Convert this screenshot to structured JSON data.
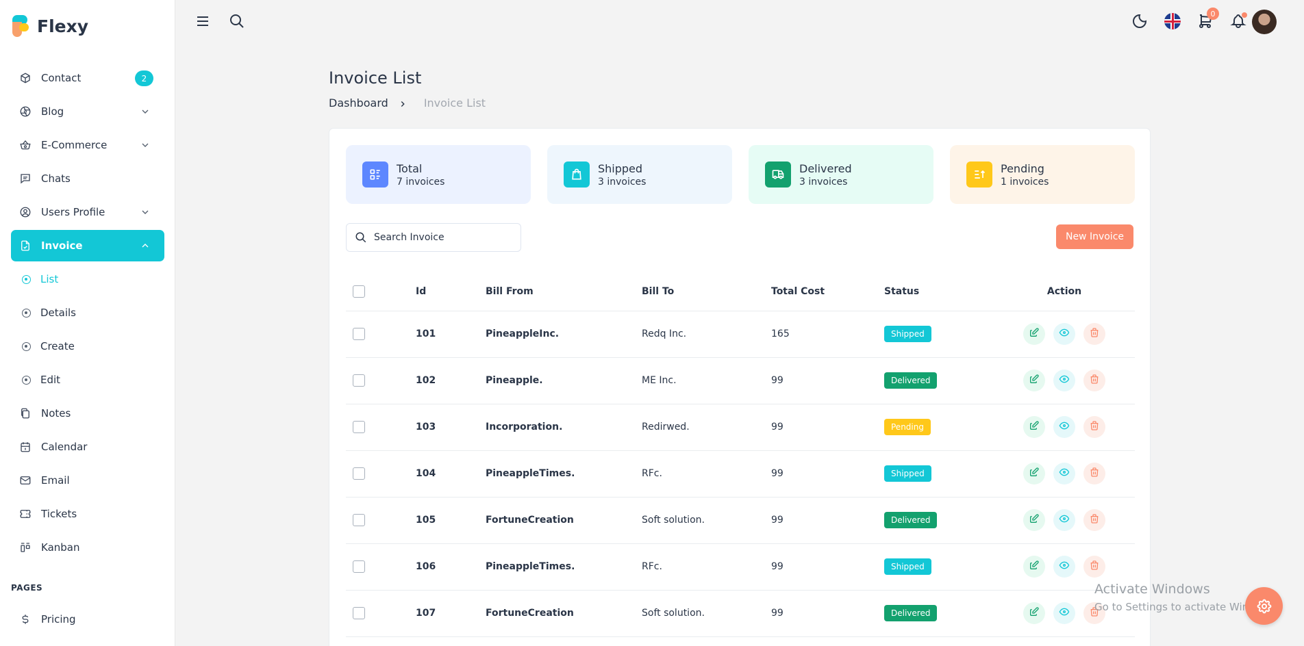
{
  "brand": {
    "name": "Flexy"
  },
  "sidebar": {
    "items": [
      {
        "label": "Contact",
        "badge": "2",
        "icon": "package-icon"
      },
      {
        "label": "Blog",
        "icon": "aperture-icon"
      },
      {
        "label": "E-Commerce",
        "icon": "basket-icon"
      },
      {
        "label": "Chats",
        "icon": "message-icon"
      },
      {
        "label": "Users Profile",
        "icon": "user-circle-icon"
      },
      {
        "label": "Invoice",
        "icon": "file-check-icon"
      }
    ],
    "sub_items": [
      {
        "label": "List"
      },
      {
        "label": "Details"
      },
      {
        "label": "Create"
      },
      {
        "label": "Edit"
      }
    ],
    "more_items": [
      {
        "label": "Notes",
        "icon": "notes-icon"
      },
      {
        "label": "Calendar",
        "icon": "calendar-icon"
      },
      {
        "label": "Email",
        "icon": "mail-icon"
      },
      {
        "label": "Tickets",
        "icon": "ticket-icon"
      },
      {
        "label": "Kanban",
        "icon": "kanban-icon"
      }
    ],
    "section_label": "PAGES",
    "bottom_items": [
      {
        "label": "Pricing",
        "icon": "currency-dollar-icon"
      }
    ]
  },
  "topbar": {
    "cart_count": "0"
  },
  "page": {
    "title": "Invoice List",
    "breadcrumb": [
      "Dashboard",
      "Invoice List"
    ]
  },
  "stats": [
    {
      "title": "Total",
      "subtitle": "7 invoices",
      "color": "#5d87ff",
      "bg": "#ecf2ff"
    },
    {
      "title": "Shipped",
      "subtitle": "3 invoices",
      "color": "#13c7d6",
      "bg": "#eef6fd"
    },
    {
      "title": "Delivered",
      "subtitle": "3 invoices",
      "color": "#13a16e",
      "bg": "#e6fcf5"
    },
    {
      "title": "Pending",
      "subtitle": "1 invoices",
      "color": "#ffc81a",
      "bg": "#fef4e8"
    }
  ],
  "search": {
    "placeholder": "Search Invoice"
  },
  "new_invoice_label": "New Invoice",
  "table": {
    "headers": [
      "Id",
      "Bill From",
      "Bill To",
      "Total Cost",
      "Status",
      "Action"
    ],
    "rows": [
      {
        "id": "101",
        "from": "PineappleInc.",
        "to": "Redq Inc.",
        "cost": "165",
        "status": "Shipped"
      },
      {
        "id": "102",
        "from": "Pineapple.",
        "to": "ME Inc.",
        "cost": "99",
        "status": "Delivered"
      },
      {
        "id": "103",
        "from": "Incorporation.",
        "to": "Redirwed.",
        "cost": "99",
        "status": "Pending"
      },
      {
        "id": "104",
        "from": "PineappleTimes.",
        "to": "RFc.",
        "cost": "99",
        "status": "Shipped"
      },
      {
        "id": "105",
        "from": "FortuneCreation",
        "to": "Soft solution.",
        "cost": "99",
        "status": "Delivered"
      },
      {
        "id": "106",
        "from": "PineappleTimes.",
        "to": "RFc.",
        "cost": "99",
        "status": "Shipped"
      },
      {
        "id": "107",
        "from": "FortuneCreation",
        "to": "Soft solution.",
        "cost": "99",
        "status": "Delivered"
      }
    ]
  },
  "status_colors": {
    "Shipped": "#13c7d6",
    "Delivered": "#13a16e",
    "Pending": "#ffc81a"
  },
  "watermark": {
    "line1": "Activate Windows",
    "line2": "Go to Settings to activate Windows."
  }
}
